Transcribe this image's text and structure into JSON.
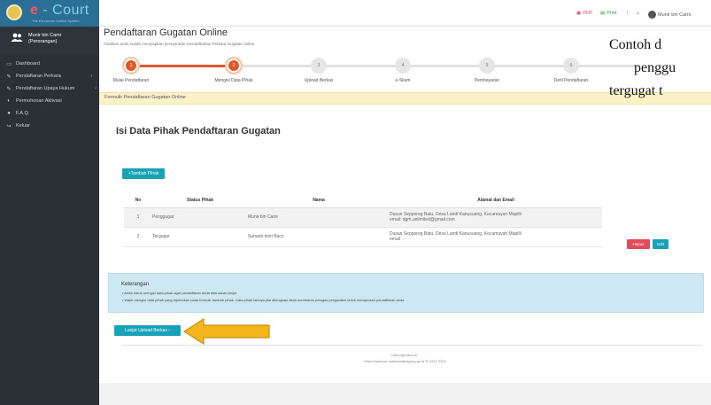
{
  "brand": {
    "e": "e",
    "name": "Court",
    "tagline": "The Electronic Justice System"
  },
  "user": {
    "name": "Munir bin Cami (Perorangan)"
  },
  "sidebar": {
    "items": [
      {
        "label": "Dashboard",
        "icon": "monitor-icon"
      },
      {
        "label": "Pendaftaran Perkara",
        "icon": "edit-icon"
      },
      {
        "label": "Pendaftaran Upaya Hukum",
        "icon": "edit-icon"
      },
      {
        "label": "Permohonan Aktivasi",
        "icon": "toggle-icon"
      },
      {
        "label": "F.A.Q.",
        "icon": "info-icon"
      },
      {
        "label": "Keluar",
        "icon": "logout-icon"
      }
    ]
  },
  "topbar": {
    "pdf": "PDF",
    "print": "Print",
    "user": "Munir bin Cami"
  },
  "page": {
    "title": "Pendaftaran Gugatan Online",
    "subtitle": "Pastikan anda sudah menyiapkan persyaratan mendaftarkan Perkara Gugatan online"
  },
  "steps": [
    {
      "num": "1",
      "label": "Mulai Pendaftaran"
    },
    {
      "num": "2",
      "label": "Mengisi Data Pihak"
    },
    {
      "num": "3",
      "label": "Upload Berkas"
    },
    {
      "num": "4",
      "label": "e-Skum"
    },
    {
      "num": "5",
      "label": "Pembayaran"
    },
    {
      "num": "6",
      "label": "Detil Pendaftaran"
    }
  ],
  "form_bar": "Formulir Pendaftaran Gugatan Online",
  "caption": {
    "line1": "Contoh d",
    "line2": "penggu",
    "line3": "tergugat t"
  },
  "section_title": "Isi Data Pihak Pendaftaran Gugatan",
  "btn_tambah": "+Tambah Pihak",
  "table": {
    "headers": [
      "No",
      "Status Pihak",
      "Nama",
      "Alamat dan Email"
    ],
    "rows": [
      {
        "no": "1",
        "status": "Penggugat",
        "nama": "Munir bin Cami",
        "alamat": "Dusun Sepporeg Batu, Desa Landi Kanusuang, Kecamayan Mapilli",
        "email": "email: dgm.unlimited@gmail.com"
      },
      {
        "no": "2",
        "status": "Tergugat",
        "nama": "Sunaeb binti Baco",
        "alamat": "Dusun Sepporeg Batu, Desa Landi Kanusuang, Kecamayan Mapilli",
        "email": "email : -"
      }
    ],
    "row_actions": {
      "hapus": "Hapus",
      "edit": "Edit"
    }
  },
  "keterangan": {
    "title": "Keterangan",
    "items": [
      "• Anda harus mengisi data pihak agar pendaftaran anda diteruskan lanjut",
      "• Wajib mengisi data pihak yang diperlukan pada formulir tambah pihak. Data pihak lainnya jika dilengkapi akan membantu petugas pengadilan untuk memproses pendaftaran anda"
    ]
  },
  "btn_lanjut": "Lanjut Upload Berkas",
  "footer": {
    "line1": "Hubungi kami di :",
    "line2": "https://www.pn-mahkamahagung.go.id   ✆ 0431 2324"
  },
  "colors": {
    "accent": "#17a2b8",
    "step_active": "#e0592a",
    "arrow": "#f3b61b",
    "danger": "#e04b5a"
  }
}
